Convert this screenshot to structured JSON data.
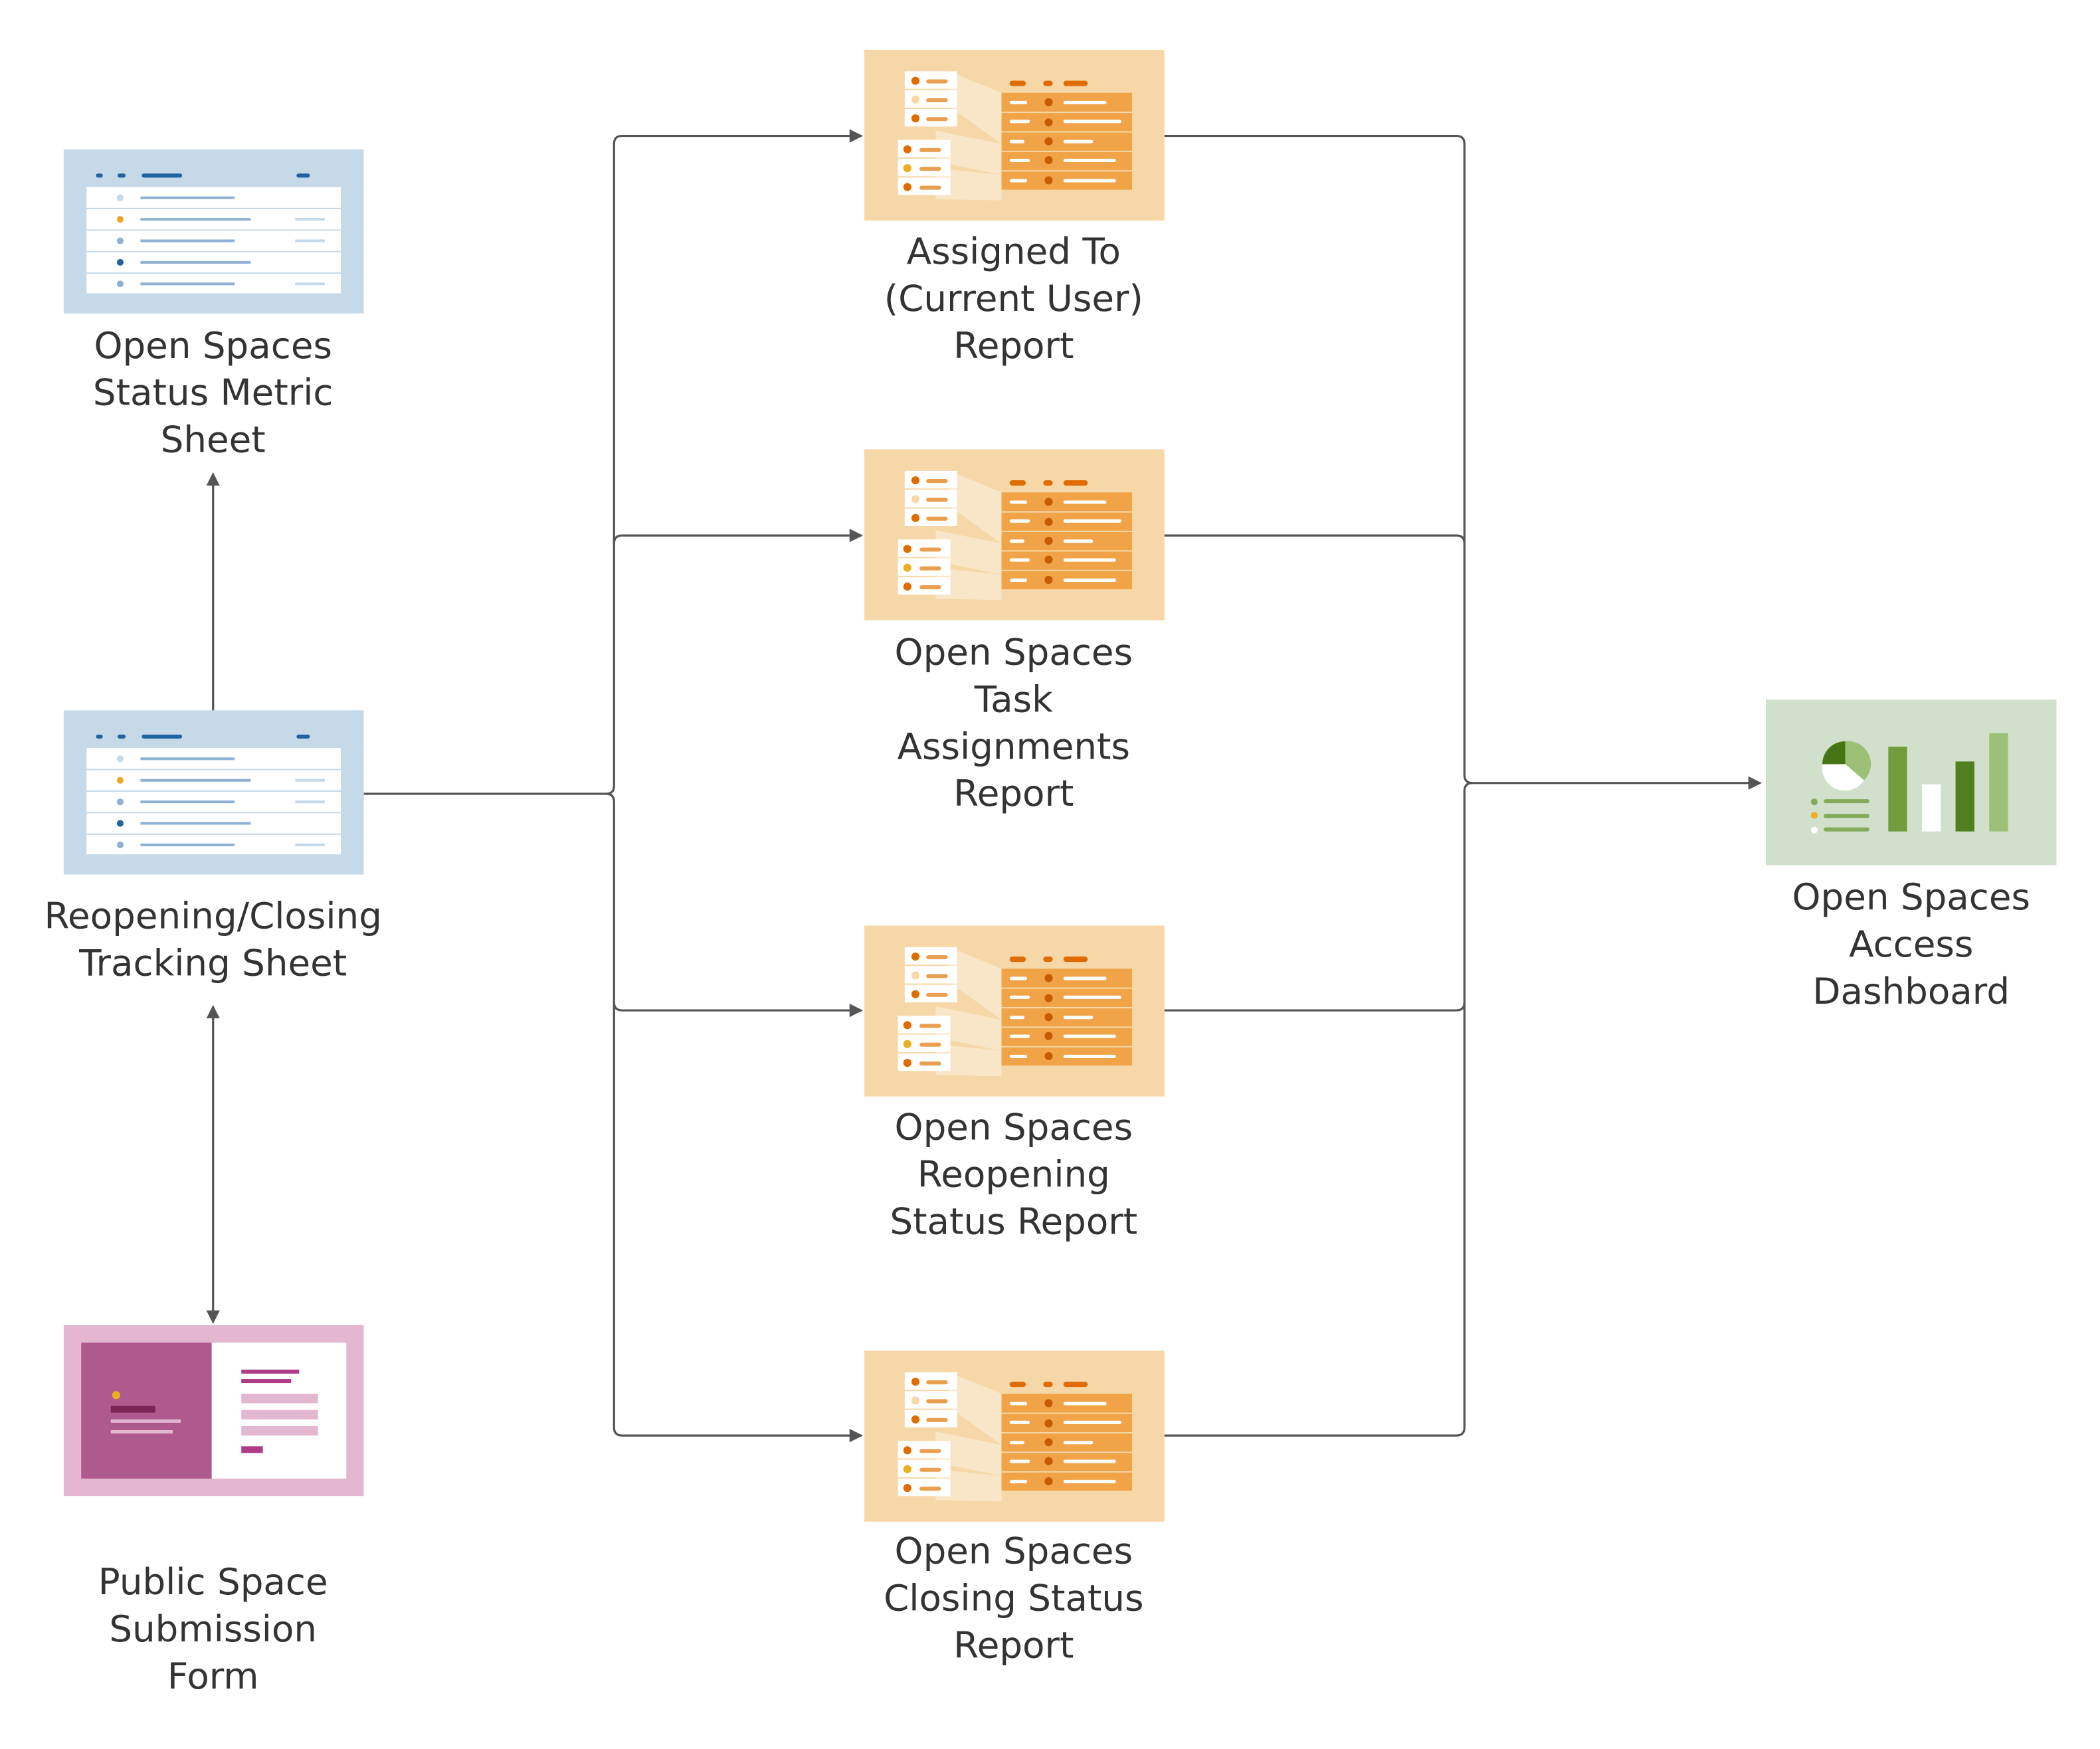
{
  "nodes": {
    "status_metric_sheet": {
      "type": "sheet",
      "label": [
        "Open Spaces",
        "Status Metric",
        "Sheet"
      ]
    },
    "tracking_sheet": {
      "type": "sheet",
      "label": [
        "Reopening/Closing",
        "Tracking Sheet"
      ]
    },
    "submission_form": {
      "type": "form",
      "label": [
        "Public Space",
        "Submission",
        "Form"
      ]
    },
    "assigned_report": {
      "type": "report",
      "label": [
        "Assigned To",
        "(Current User)",
        "Report"
      ]
    },
    "task_report": {
      "type": "report",
      "label": [
        "Open Spaces",
        "Task",
        "Assignments",
        "Report"
      ]
    },
    "reopening_report": {
      "type": "report",
      "label": [
        "Open Spaces",
        "Reopening",
        "Status Report"
      ]
    },
    "closing_report": {
      "type": "report",
      "label": [
        "Open Spaces",
        "Closing Status",
        "Report"
      ]
    },
    "dashboard": {
      "type": "dashboard",
      "label": [
        "Open Spaces",
        "Access",
        "Dashboard"
      ]
    }
  },
  "edges": [
    {
      "from": "tracking_sheet",
      "to": "status_metric_sheet"
    },
    {
      "from": "tracking_sheet",
      "to": "submission_form",
      "bidirectional": true
    },
    {
      "from": "tracking_sheet",
      "to": "assigned_report"
    },
    {
      "from": "tracking_sheet",
      "to": "task_report"
    },
    {
      "from": "tracking_sheet",
      "to": "reopening_report"
    },
    {
      "from": "tracking_sheet",
      "to": "closing_report"
    },
    {
      "from": "assigned_report",
      "to": "dashboard"
    },
    {
      "from": "task_report",
      "to": "dashboard"
    },
    {
      "from": "reopening_report",
      "to": "dashboard"
    },
    {
      "from": "closing_report",
      "to": "dashboard"
    }
  ],
  "colors": {
    "sheet": "#c5d9e9",
    "report": "#f6d7a7",
    "form": "#e4b7d1",
    "dashboard": "#d0e0ca",
    "connector": "#555555"
  }
}
